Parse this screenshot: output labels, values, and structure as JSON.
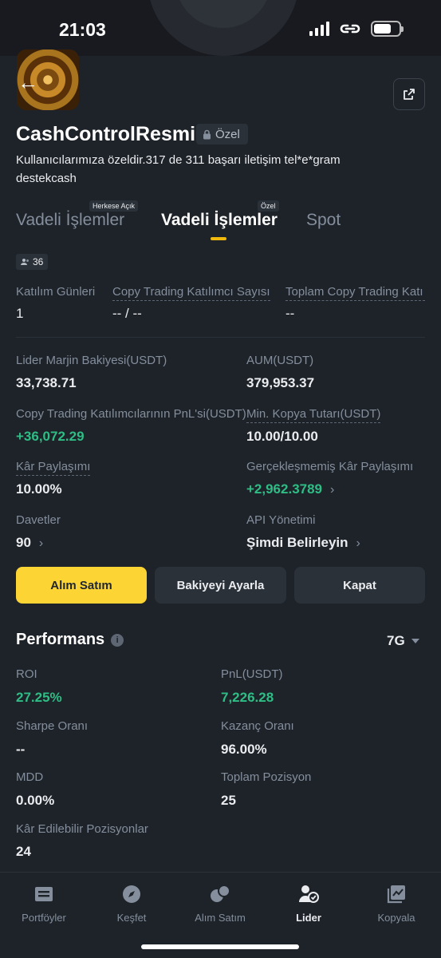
{
  "status_bar": {
    "time": "21:03"
  },
  "profile": {
    "name": "CashControlResmi",
    "privacy_badge": "Özel",
    "bio": "Kullanıcılarımıza özeldir.317 de 311 başarı iletişim tel*e*gram destekcash"
  },
  "tabs": [
    {
      "label": "Vadeli İşlemler",
      "badge": "Herkese Açık",
      "active": false
    },
    {
      "label": "Vadeli İşlemler",
      "badge": "Özel",
      "active": true
    },
    {
      "label": "Spot",
      "badge": "",
      "active": false
    }
  ],
  "followers_count": "36",
  "stats_row": [
    {
      "label": "Katılım Günleri",
      "value": "1"
    },
    {
      "label": "Copy Trading Katılımcı Sayısı",
      "value": "-- / --"
    },
    {
      "label": "Toplam Copy Trading Katı",
      "value": "--"
    }
  ],
  "details": {
    "lead_margin": {
      "label": "Lider Marjin Bakiyesi(USDT)",
      "value": "33,738.71"
    },
    "aum": {
      "label": "AUM(USDT)",
      "value": "379,953.37"
    },
    "copier_pnl": {
      "label": "Copy Trading Katılımcılarının PnL'si(USDT)",
      "value": "+36,072.29"
    },
    "min_copy": {
      "label": "Min. Kopya Tutarı(USDT)",
      "value": "10.00/10.00"
    },
    "profit_share": {
      "label": "Kâr Paylaşımı",
      "value": "10.00%"
    },
    "unrealized_share": {
      "label": "Gerçekleşmemiş Kâr Paylaşımı",
      "value": "+2,962.3789"
    },
    "invites": {
      "label": "Davetler",
      "value": "90"
    },
    "api": {
      "label": "API Yönetimi",
      "value": "Şimdi Belirleyin"
    }
  },
  "buttons": {
    "trade": "Alım Satım",
    "adjust_balance": "Bakiyeyi Ayarla",
    "close": "Kapat"
  },
  "performance": {
    "title": "Performans",
    "period": "7G",
    "metrics": {
      "roi": {
        "label": "ROI",
        "value": "27.25%"
      },
      "pnl": {
        "label": "PnL(USDT)",
        "value": "7,226.28"
      },
      "sharpe": {
        "label": "Sharpe Oranı",
        "value": "--"
      },
      "win_rate": {
        "label": "Kazanç Oranı",
        "value": "96.00%"
      },
      "mdd": {
        "label": "MDD",
        "value": "0.00%"
      },
      "total_positions": {
        "label": "Toplam Pozisyon",
        "value": "25"
      },
      "profitable_positions": {
        "label": "Kâr Edilebilir Pozisyonlar",
        "value": "24"
      }
    }
  },
  "nav": [
    {
      "label": "Portföyler",
      "icon": "portfolio-icon",
      "active": false
    },
    {
      "label": "Keşfet",
      "icon": "compass-icon",
      "active": false
    },
    {
      "label": "Alım Satım",
      "icon": "trade-icon",
      "active": false
    },
    {
      "label": "Lider",
      "icon": "leader-icon",
      "active": true
    },
    {
      "label": "Kopyala",
      "icon": "copy-chart-icon",
      "active": false
    }
  ],
  "colors": {
    "background": "#1e2329",
    "accent": "#fcd535",
    "positive": "#2ebd85",
    "muted": "#848e9c"
  }
}
